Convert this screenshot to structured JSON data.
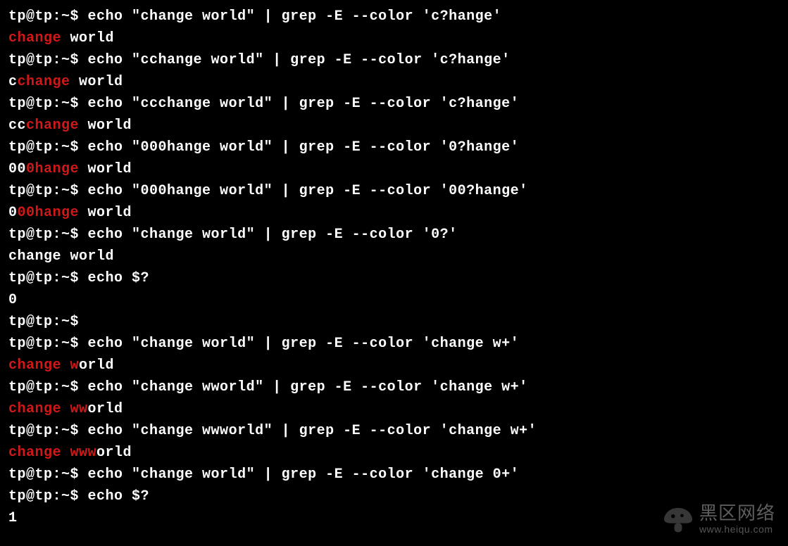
{
  "prompt": "tp@tp:~$ ",
  "lines": [
    {
      "type": "cmd",
      "cmd": "echo \"change world\" | grep -E --color 'c?hange'"
    },
    {
      "type": "out",
      "segments": [
        {
          "t": "change",
          "m": true
        },
        {
          "t": " world",
          "m": false
        }
      ]
    },
    {
      "type": "cmd",
      "cmd": "echo \"cchange world\" | grep -E --color 'c?hange'"
    },
    {
      "type": "out",
      "segments": [
        {
          "t": "c",
          "m": false
        },
        {
          "t": "change",
          "m": true
        },
        {
          "t": " world",
          "m": false
        }
      ]
    },
    {
      "type": "cmd",
      "cmd": "echo \"ccchange world\" | grep -E --color 'c?hange'"
    },
    {
      "type": "out",
      "segments": [
        {
          "t": "cc",
          "m": false
        },
        {
          "t": "change",
          "m": true
        },
        {
          "t": " world",
          "m": false
        }
      ]
    },
    {
      "type": "cmd",
      "cmd": "echo \"000hange world\" | grep -E --color '0?hange'"
    },
    {
      "type": "out",
      "segments": [
        {
          "t": "00",
          "m": false
        },
        {
          "t": "0hange",
          "m": true
        },
        {
          "t": " world",
          "m": false
        }
      ]
    },
    {
      "type": "cmd",
      "cmd": "echo \"000hange world\" | grep -E --color '00?hange'"
    },
    {
      "type": "out",
      "segments": [
        {
          "t": "0",
          "m": false
        },
        {
          "t": "00hange",
          "m": true
        },
        {
          "t": " world",
          "m": false
        }
      ]
    },
    {
      "type": "cmd",
      "cmd": "echo \"change world\" | grep -E --color '0?'"
    },
    {
      "type": "out",
      "segments": [
        {
          "t": "change world",
          "m": false
        }
      ]
    },
    {
      "type": "cmd",
      "cmd": "echo $?"
    },
    {
      "type": "out",
      "segments": [
        {
          "t": "0",
          "m": false
        }
      ]
    },
    {
      "type": "cmd",
      "cmd": ""
    },
    {
      "type": "cmd",
      "cmd": "echo \"change world\" | grep -E --color 'change w+'"
    },
    {
      "type": "out",
      "segments": [
        {
          "t": "change w",
          "m": true
        },
        {
          "t": "orld",
          "m": false
        }
      ]
    },
    {
      "type": "cmd",
      "cmd": "echo \"change wworld\" | grep -E --color 'change w+'"
    },
    {
      "type": "out",
      "segments": [
        {
          "t": "change ww",
          "m": true
        },
        {
          "t": "orld",
          "m": false
        }
      ]
    },
    {
      "type": "cmd",
      "cmd": "echo \"change wwworld\" | grep -E --color 'change w+'"
    },
    {
      "type": "out",
      "segments": [
        {
          "t": "change www",
          "m": true
        },
        {
          "t": "orld",
          "m": false
        }
      ]
    },
    {
      "type": "cmd",
      "cmd": "echo \"change world\" | grep -E --color 'change 0+'"
    },
    {
      "type": "cmd",
      "cmd": "echo $?"
    },
    {
      "type": "out",
      "segments": [
        {
          "t": "1",
          "m": false
        }
      ]
    }
  ],
  "watermark": {
    "brand": "黑区网络",
    "url": "www.heiqu.com"
  }
}
